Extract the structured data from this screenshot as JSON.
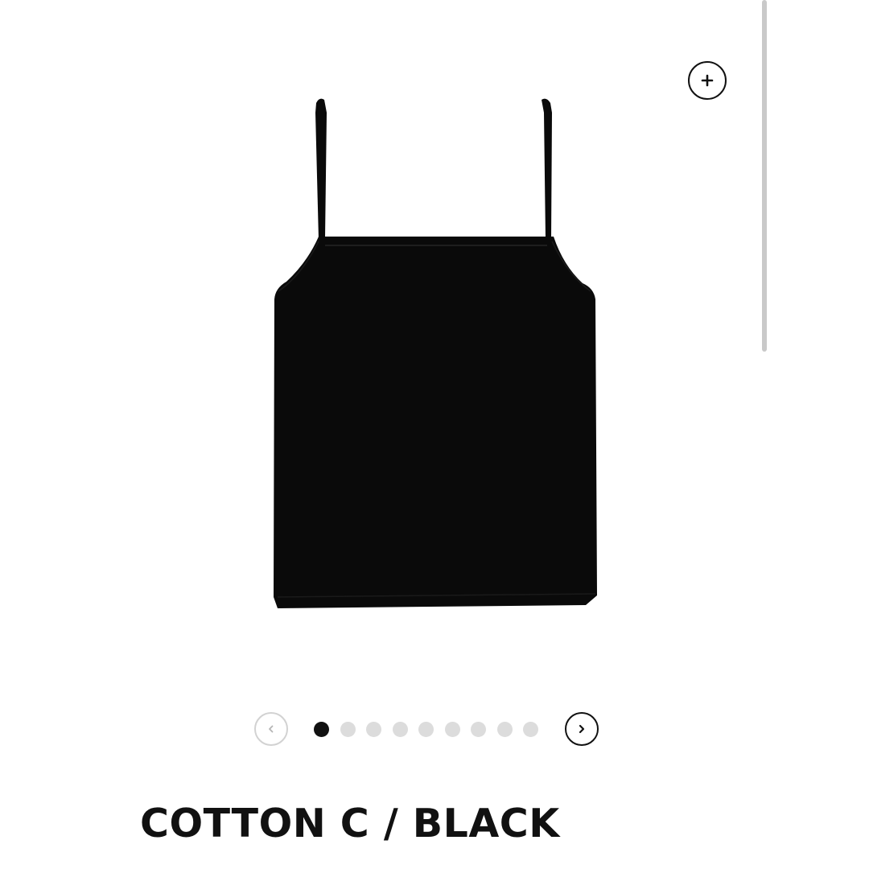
{
  "product": {
    "title": "COTTON C / BLACK",
    "image_name": "black camisole product photo",
    "color": "#0a0a0a"
  },
  "zoom_button": {
    "icon": "plus-icon"
  },
  "carousel": {
    "prev_icon": "chevron-left-icon",
    "next_icon": "chevron-right-icon",
    "total_slides": 9,
    "current_slide": 1,
    "active_color": "#111111",
    "inactive_color": "#dcdcdc"
  }
}
